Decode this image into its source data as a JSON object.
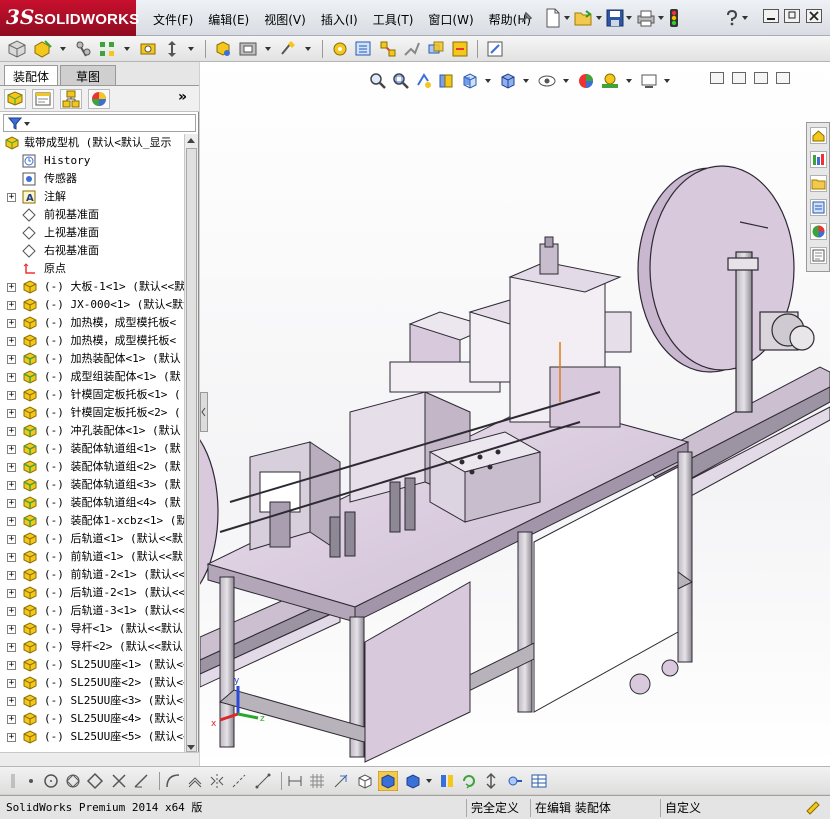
{
  "app": {
    "brand_mark": "3S",
    "brand_name": "SOLIDWORKS"
  },
  "menu": [
    "文件(F)",
    "编辑(E)",
    "视图(V)",
    "插入(I)",
    "工具(T)",
    "窗口(W)",
    "帮助(H)"
  ],
  "left_panel": {
    "tabs": [
      "装配体",
      "草图"
    ],
    "active_tab": "装配体",
    "collapse_glyph": "»",
    "tree": [
      {
        "label": "载带成型机  (默认<默认_显示",
        "icon": "assembly-icon",
        "top": true
      },
      {
        "label": "History",
        "icon": "history-icon"
      },
      {
        "label": "传感器",
        "icon": "sensor-icon"
      },
      {
        "label": "注解",
        "icon": "annotation-icon",
        "expand": true
      },
      {
        "label": "前视基准面",
        "icon": "plane-icon"
      },
      {
        "label": "上视基准面",
        "icon": "plane-icon"
      },
      {
        "label": "右视基准面",
        "icon": "plane-icon"
      },
      {
        "label": "原点",
        "icon": "origin-icon"
      },
      {
        "label": "(-) 大板-1<1> (默认<<默",
        "icon": "part-icon",
        "expand": true
      },
      {
        "label": "(-) JX-000<1> (默认<默认",
        "icon": "part-icon",
        "expand": true
      },
      {
        "label": "(-) 加热模，成型模托板<",
        "icon": "part-icon",
        "expand": true
      },
      {
        "label": "(-) 加热模，成型模托板<",
        "icon": "part-icon",
        "expand": true
      },
      {
        "label": "(-) 加热装配体<1> (默认",
        "icon": "subassembly-icon",
        "expand": true
      },
      {
        "label": "(-) 成型组装配体<1> (默",
        "icon": "subassembly-icon",
        "expand": true
      },
      {
        "label": "(-) 针模固定板托板<1> (",
        "icon": "part-icon",
        "expand": true
      },
      {
        "label": "(-) 针模固定板托板<2> (",
        "icon": "part-icon",
        "expand": true
      },
      {
        "label": "(-) 冲孔装配体<1> (默认",
        "icon": "subassembly-icon",
        "expand": true
      },
      {
        "label": "(-) 装配体轨道组<1> (默",
        "icon": "subassembly-icon",
        "expand": true
      },
      {
        "label": "(-) 装配体轨道组<2> (默",
        "icon": "subassembly-icon",
        "expand": true
      },
      {
        "label": "(-) 装配体轨道组<3> (默",
        "icon": "subassembly-icon",
        "expand": true
      },
      {
        "label": "(-) 装配体轨道组<4> (默",
        "icon": "subassembly-icon",
        "expand": true
      },
      {
        "label": "(-) 装配体1-xcbz<1> (默",
        "icon": "subassembly-icon",
        "expand": true
      },
      {
        "label": "(-) 后轨道<1> (默认<<默",
        "icon": "part-icon",
        "expand": true
      },
      {
        "label": "(-) 前轨道<1> (默认<<默",
        "icon": "part-icon",
        "expand": true
      },
      {
        "label": "(-) 前轨道-2<1> (默认<<",
        "icon": "part-icon",
        "expand": true
      },
      {
        "label": "(-) 后轨道-2<1> (默认<<",
        "icon": "part-icon",
        "expand": true
      },
      {
        "label": "(-) 后轨道-3<1> (默认<<",
        "icon": "part-icon",
        "expand": true
      },
      {
        "label": "(-) 导杆<1> (默认<<默认",
        "icon": "part-icon",
        "expand": true
      },
      {
        "label": "(-) 导杆<2> (默认<<默认",
        "icon": "part-icon",
        "expand": true
      },
      {
        "label": "(-) SL25UU座<1> (默认<<",
        "icon": "part-icon",
        "expand": true
      },
      {
        "label": "(-) SL25UU座<2> (默认<<",
        "icon": "part-icon",
        "expand": true
      },
      {
        "label": "(-) SL25UU座<3> (默认<<",
        "icon": "part-icon",
        "expand": true
      },
      {
        "label": "(-) SL25UU座<4> (默认<<",
        "icon": "part-icon",
        "expand": true
      },
      {
        "label": "(-) SL25UU座<5> (默认<<",
        "icon": "part-icon",
        "expand": true
      }
    ]
  },
  "status": {
    "product": "SolidWorks Premium 2014 x64 版",
    "definition": "完全定义",
    "mode": "在编辑 装配体",
    "units": "自定义"
  },
  "triad": {
    "x": "x",
    "y": "y",
    "z": "z"
  },
  "colors": {
    "brand_red": "#c8102e",
    "part_yellow": "#f3c71b",
    "assembly_green": "#3ea33a",
    "model_lilac": "#d9c9dd",
    "frame_gray": "#a6a2a9"
  }
}
